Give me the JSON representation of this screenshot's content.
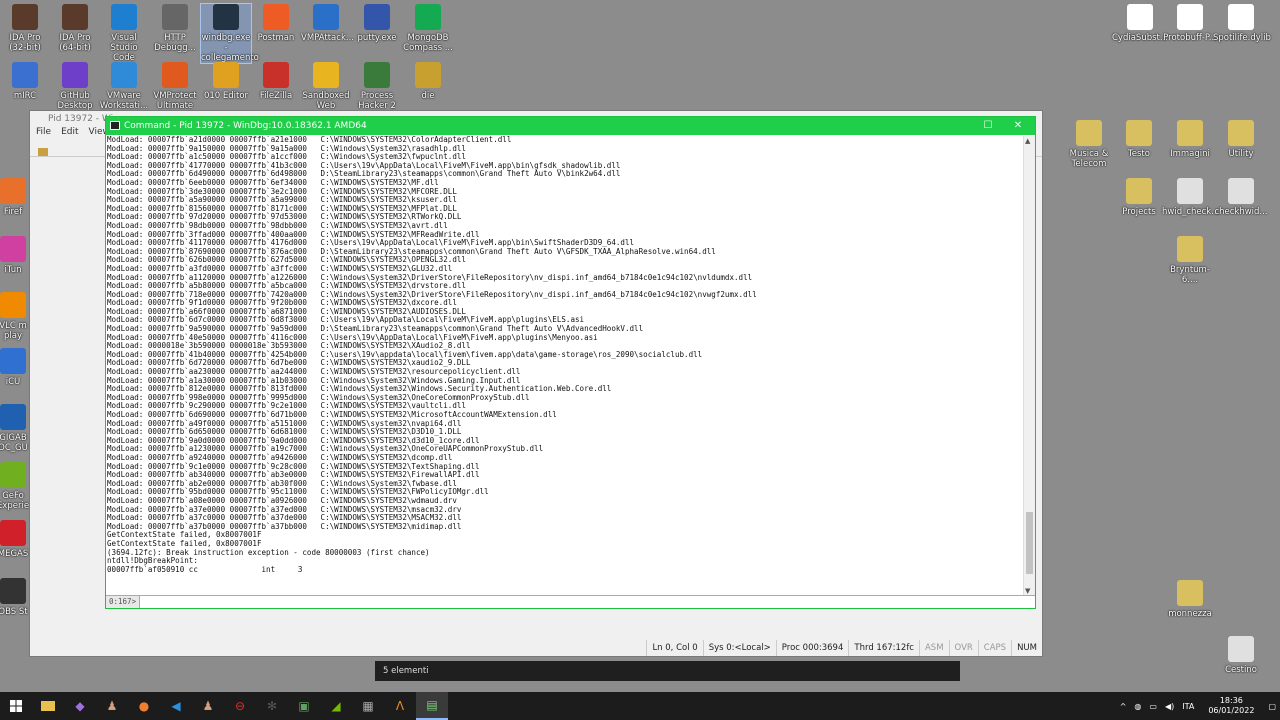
{
  "desktop": {
    "icons_left": [
      {
        "label": "IDA Pro (32-bit)",
        "color": "#5a3a2a"
      },
      {
        "label": "IDA Pro (64-bit)",
        "color": "#5a3a2a"
      },
      {
        "label": "Visual Studio Code",
        "color": "#1e7fd0"
      },
      {
        "label": "HTTP Debugg...",
        "color": "#666666"
      },
      {
        "label": "windbg.exe - collegamento",
        "color": "#223344"
      },
      {
        "label": "Postman",
        "color": "#ef5b25"
      },
      {
        "label": "VMPAttack...",
        "color": "#2a70c9"
      },
      {
        "label": "putty.exe",
        "color": "#3355aa"
      },
      {
        "label": "MongoDB Compass ...",
        "color": "#13aa52"
      }
    ],
    "icons_row2": [
      {
        "label": "mIRC",
        "color": "#3b6fd0"
      },
      {
        "label": "GitHub Desktop",
        "color": "#6e40c9"
      },
      {
        "label": "VMware Workstati...",
        "color": "#2f8bd8"
      },
      {
        "label": "VMProtect Ultimate",
        "color": "#e05a20"
      },
      {
        "label": "010 Editor",
        "color": "#e0a020"
      },
      {
        "label": "FileZilla",
        "color": "#c8302a"
      },
      {
        "label": "Sandboxed Web Browser",
        "color": "#e8b520"
      },
      {
        "label": "Process Hacker 2",
        "color": "#3a7a3a"
      },
      {
        "label": "die",
        "color": "#c8a030"
      }
    ],
    "icons_right_top": [
      {
        "label": "CydiaSubst...",
        "color": "#ffffff"
      },
      {
        "label": "Protobuff-P...",
        "color": "#ffffff"
      },
      {
        "label": "Spotilife.dylib",
        "color": "#ffffff"
      }
    ],
    "icons_right_mid": [
      {
        "label": "Musica & Telecom",
        "color": "#d8c060"
      },
      {
        "label": "Testo",
        "color": "#d8c060"
      },
      {
        "label": "Immagini",
        "color": "#d8c060"
      },
      {
        "label": "Utility",
        "color": "#d8c060"
      },
      {
        "label": "Projects",
        "color": "#d8c060"
      },
      {
        "label": "hwid_check...",
        "color": "#e0e0e0"
      },
      {
        "label": "checkhwid...",
        "color": "#e0e0e0"
      },
      {
        "label": "Bryntum-6....",
        "color": "#d8c060"
      },
      {
        "label": "monnezza",
        "color": "#d8c060"
      },
      {
        "label": "Cestino",
        "color": "#e0e0e0"
      }
    ],
    "icons_edge_left": [
      {
        "label": "Firef",
        "color": "#e8702a"
      },
      {
        "label": "iTun",
        "color": "#d040a0"
      },
      {
        "label": "VLC m play",
        "color": "#f08a00"
      },
      {
        "label": "iCU",
        "color": "#3070d0"
      },
      {
        "label": "GIGAB OC_GU",
        "color": "#2060b0"
      },
      {
        "label": "GeFo Experie",
        "color": "#70b020"
      },
      {
        "label": "MEGAS",
        "color": "#d0202a"
      },
      {
        "label": "OBS St",
        "color": "#333333"
      }
    ]
  },
  "windbg": {
    "title": "Pid 13972 - Win",
    "menu": [
      "File",
      "Edit",
      "View"
    ]
  },
  "command_window": {
    "title": "Command - Pid 13972 - WinDbg:10.0.18362.1 AMD64",
    "prompt": "0:167>",
    "input_value": "",
    "output_lines": [
      "ModLoad: 00007ffb`a21d0000 00007ffb`a21e1000   C:\\WINDOWS\\SYSTEM32\\ColorAdapterClient.dll",
      "ModLoad: 00007ffb`9a150000 00007ffb`9a15a000   C:\\Windows\\System32\\rasadhlp.dll",
      "ModLoad: 00007ffb`a1c50000 00007ffb`a1ccf000   C:\\Windows\\System32\\fwpuclnt.dll",
      "ModLoad: 00007ffb`41770000 00007ffb`41b3c000   C:\\Users\\19v\\AppData\\Local\\FiveM\\FiveM.app\\bin\\gfsdk_shadowlib.dll",
      "ModLoad: 00007ffb`6d490000 00007ffb`6d498000   D:\\SteamLibrary23\\steamapps\\common\\Grand Theft Auto V\\bink2w64.dll",
      "ModLoad: 00007ffb`6eeb0000 00007ffb`6ef34000   C:\\WINDOWS\\SYSTEM32\\MF.dll",
      "ModLoad: 00007ffb`3de30000 00007ffb`3e2c1000   C:\\WINDOWS\\SYSTEM32\\MFCORE.DLL",
      "ModLoad: 00007ffb`a5a90000 00007ffb`a5a99000   C:\\WINDOWS\\SYSTEM32\\ksuser.dll",
      "ModLoad: 00007ffb`81560000 00007ffb`8171c000   C:\\WINDOWS\\SYSTEM32\\MFPlat.DLL",
      "ModLoad: 00007ffb`97d20000 00007ffb`97d53000   C:\\WINDOWS\\SYSTEM32\\RTWorkQ.DLL",
      "ModLoad: 00007ffb`98db0000 00007ffb`98dbb000   C:\\WINDOWS\\SYSTEM32\\avrt.dll",
      "ModLoad: 00007ffb`3ffad000 00007ffb`400aa000   C:\\WINDOWS\\SYSTEM32\\MFReadWrite.dll",
      "ModLoad: 00007ffb`41170000 00007ffb`4176d000   C:\\Users\\19v\\AppData\\Local\\FiveM\\FiveM.app\\bin\\SwiftShaderD3D9_64.dll",
      "ModLoad: 00007ffb`87690000 00007ffb`876ac000   D:\\SteamLibrary23\\steamapps\\common\\Grand Theft Auto V\\GFSDK_TXAA_AlphaResolve.win64.dll",
      "ModLoad: 00007ffb`626b0000 00007ffb`627d5000   C:\\WINDOWS\\SYSTEM32\\OPENGL32.dll",
      "ModLoad: 00007ffb`a3fd0000 00007ffb`a3ffc000   C:\\WINDOWS\\SYSTEM32\\GLU32.dll",
      "ModLoad: 00007ffb`a1120000 00007ffb`a1226000   C:\\Windows\\System32\\DriverStore\\FileRepository\\nv_dispi.inf_amd64_b7184c0e1c94c102\\nvldumdx.dll",
      "ModLoad: 00007ffb`a5b80000 00007ffb`a5bca000   C:\\WINDOWS\\SYSTEM32\\drvstore.dll",
      "ModLoad: 00007ffb`718e0000 00007ffb`7420a000   C:\\Windows\\System32\\DriverStore\\FileRepository\\nv_dispi.inf_amd64_b7184c0e1c94c102\\nvwgf2umx.dll",
      "ModLoad: 00007ffb`9f1d0000 00007ffb`9f20b000   C:\\WINDOWS\\SYSTEM32\\dxcore.dll",
      "ModLoad: 00007ffb`a66f0000 00007ffb`a6871000   C:\\WINDOWS\\SYSTEM32\\AUDIOSES.DLL",
      "ModLoad: 00007ffb`6d7c0000 00007ffb`6d8f3000   C:\\Users\\19v\\AppData\\Local\\FiveM\\FiveM.app\\plugins\\ELS.asi",
      "ModLoad: 00007ffb`9a590000 00007ffb`9a59d000   D:\\SteamLibrary23\\steamapps\\common\\Grand Theft Auto V\\AdvancedHookV.dll",
      "ModLoad: 00007ffb`40e50000 00007ffb`4116c000   C:\\Users\\19v\\AppData\\Local\\FiveM\\FiveM.app\\plugins\\Menyoo.asi",
      "ModLoad: 0000018e`3b590000 0000018e`3b593000   C:\\WINDOWS\\SYSTEM32\\XAudio2_8.dll",
      "ModLoad: 00007ffb`41b40000 00007ffb`4254b000   C:\\users\\19v\\appdata\\local\\fivem\\fivem.app\\data\\game-storage\\ros_2090\\socialclub.dll",
      "ModLoad: 00007ffb`6d720000 00007ffb`6d7be000   C:\\WINDOWS\\SYSTEM32\\xaudio2_9.DLL",
      "ModLoad: 00007ffb`aa230000 00007ffb`aa244000   C:\\WINDOWS\\SYSTEM32\\resourcepolicyclient.dll",
      "ModLoad: 00007ffb`a1a30000 00007ffb`a1b03000   C:\\Windows\\System32\\Windows.Gaming.Input.dll",
      "ModLoad: 00007ffb`812e0000 00007ffb`813fd000   C:\\Windows\\System32\\Windows.Security.Authentication.Web.Core.dll",
      "ModLoad: 00007ffb`998e0000 00007ffb`9995d000   C:\\Windows\\System32\\OneCoreCommonProxyStub.dll",
      "ModLoad: 00007ffb`9c290000 00007ffb`9c2e1000   C:\\WINDOWS\\SYSTEM32\\vaultcli.dll",
      "ModLoad: 00007ffb`6d690000 00007ffb`6d71b000   C:\\WINDOWS\\SYSTEM32\\MicrosoftAccountWAMExtension.dll",
      "ModLoad: 00007ffb`a49f0000 00007ffb`a5151000   C:\\WINDOWS\\system32\\nvapi64.dll",
      "ModLoad: 00007ffb`6d650000 00007ffb`6d681000   C:\\WINDOWS\\SYSTEM32\\D3D10_1.DLL",
      "ModLoad: 00007ffb`9a0d0000 00007ffb`9a0dd000   C:\\WINDOWS\\SYSTEM32\\d3d10_1core.dll",
      "ModLoad: 00007ffb`a1230000 00007ffb`a19c7000   C:\\Windows\\System32\\OneCoreUAPCommonProxyStub.dll",
      "ModLoad: 00007ffb`a9240000 00007ffb`a9426000   C:\\WINDOWS\\SYSTEM32\\dcomp.dll",
      "ModLoad: 00007ffb`9c1e0000 00007ffb`9c28c000   C:\\WINDOWS\\SYSTEM32\\TextShaping.dll",
      "ModLoad: 00007ffb`ab340000 00007ffb`ab3e0000   C:\\WINDOWS\\SYSTEM32\\FirewallAPI.dll",
      "ModLoad: 00007ffb`ab2e0000 00007ffb`ab30f000   C:\\Windows\\System32\\fwbase.dll",
      "ModLoad: 00007ffb`95bd0000 00007ffb`95c11000   C:\\WINDOWS\\SYSTEM32\\FWPolicyIOMgr.dll",
      "ModLoad: 00007ffb`a08e0000 00007ffb`a0926000   C:\\WINDOWS\\SYSTEM32\\wdmaud.drv",
      "ModLoad: 00007ffb`a37e0000 00007ffb`a37ed000   C:\\WINDOWS\\SYSTEM32\\msacm32.drv",
      "ModLoad: 00007ffb`a37c0000 00007ffb`a37de000   C:\\WINDOWS\\SYSTEM32\\MSACM32.dll",
      "ModLoad: 00007ffb`a37b0000 00007ffb`a37bb000   C:\\WINDOWS\\SYSTEM32\\midimap.dll",
      "GetContextState failed, 0x8007001F",
      "GetContextState failed, 0x8007001F",
      "(3694.12fc): Break instruction exception - code 80000003 (first chance)",
      "ntdll!DbgBreakPoint:",
      "00007ffb`af050910 cc              int     3"
    ]
  },
  "status_bar": {
    "cells": [
      "Ln 0, Col 0",
      "Sys 0:<Local>",
      "Proc 000:3694",
      "Thrd 167:12fc",
      "ASM",
      "OVR",
      "CAPS",
      "NUM"
    ]
  },
  "explorer": {
    "items_count": "5 elementi"
  },
  "taskbar": {
    "lang": "ITA",
    "time": "18:36",
    "date": "06/01/2022"
  }
}
